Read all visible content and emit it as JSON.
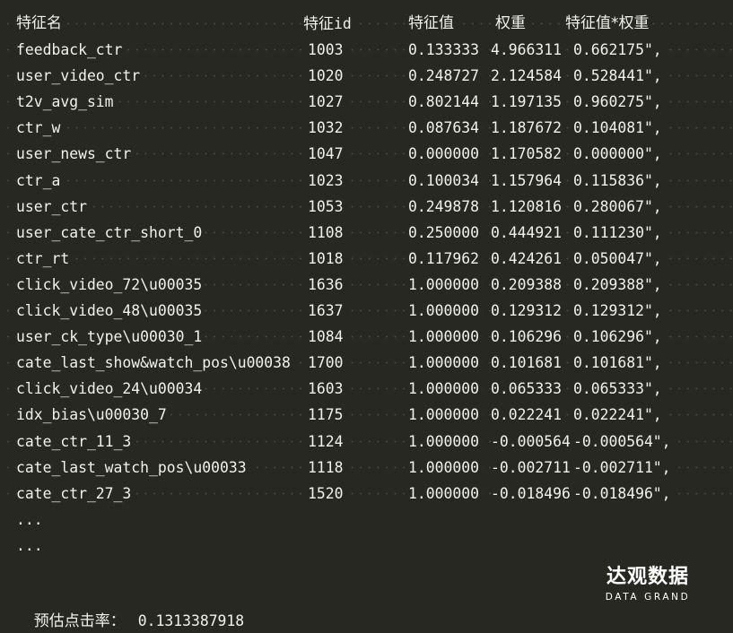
{
  "table": {
    "headers": {
      "name": "特征名",
      "id_prefix": "特征",
      "id_suffix": "id",
      "value": "特征值",
      "weight": "权重",
      "product": "特征值*权重"
    },
    "rows": [
      {
        "name": "feedback_ctr",
        "id": "1003",
        "value": "0.133333",
        "weight": "4.966311",
        "product": "0.662175\","
      },
      {
        "name": "user_video_ctr",
        "id": "1020",
        "value": "0.248727",
        "weight": "2.124584",
        "product": "0.528441\","
      },
      {
        "name": "t2v_avg_sim",
        "id": "1027",
        "value": "0.802144",
        "weight": "1.197135",
        "product": "0.960275\","
      },
      {
        "name": "ctr_w",
        "id": "1032",
        "value": "0.087634",
        "weight": "1.187672",
        "product": "0.104081\","
      },
      {
        "name": "user_news_ctr",
        "id": "1047",
        "value": "0.000000",
        "weight": "1.170582",
        "product": "0.000000\","
      },
      {
        "name": "ctr_a",
        "id": "1023",
        "value": "0.100034",
        "weight": "1.157964",
        "product": "0.115836\","
      },
      {
        "name": "user_ctr",
        "id": "1053",
        "value": "0.249878",
        "weight": "1.120816",
        "product": "0.280067\","
      },
      {
        "name": "user_cate_ctr_short_0",
        "id": "1108",
        "value": "0.250000",
        "weight": "0.444921",
        "product": "0.111230\","
      },
      {
        "name": "ctr_rt",
        "id": "1018",
        "value": "0.117962",
        "weight": "0.424261",
        "product": "0.050047\","
      },
      {
        "name": "click_video_72\\u00035",
        "id": "1636",
        "value": "1.000000",
        "weight": "0.209388",
        "product": "0.209388\","
      },
      {
        "name": "click_video_48\\u00035",
        "id": "1637",
        "value": "1.000000",
        "weight": "0.129312",
        "product": "0.129312\","
      },
      {
        "name": "user_ck_type\\u00030_1",
        "id": "1084",
        "value": "1.000000",
        "weight": "0.106296",
        "product": "0.106296\","
      },
      {
        "name": "cate_last_show&watch_pos\\u00038",
        "id": "1700",
        "value": "1.000000",
        "weight": "0.101681",
        "product": "0.101681\","
      },
      {
        "name": "click_video_24\\u00034",
        "id": "1603",
        "value": "1.000000",
        "weight": "0.065333",
        "product": "0.065333\","
      },
      {
        "name": "idx_bias\\u00030_7",
        "id": "1175",
        "value": "1.000000",
        "weight": "0.022241",
        "product": "0.022241\","
      },
      {
        "name": "cate_ctr_11_3",
        "id": "1124",
        "value": "1.000000",
        "weight": "-0.000564",
        "product": "-0.000564\","
      },
      {
        "name": "cate_last_watch_pos\\u00033",
        "id": "1118",
        "value": "1.000000",
        "weight": "-0.002711",
        "product": "-0.002711\","
      },
      {
        "name": "cate_ctr_27_3",
        "id": "1520",
        "value": "1.000000",
        "weight": "-0.018496",
        "product": "-0.018496\","
      }
    ],
    "ellipsis": [
      "...",
      "..."
    ]
  },
  "footer": {
    "label": "预估点击率：",
    "value": "0.1313387918"
  },
  "logo": {
    "name_cn": "达观数据",
    "name_en": "DATA GRAND"
  },
  "colors": {
    "background": "#272822",
    "text": "#f2f2ec"
  }
}
